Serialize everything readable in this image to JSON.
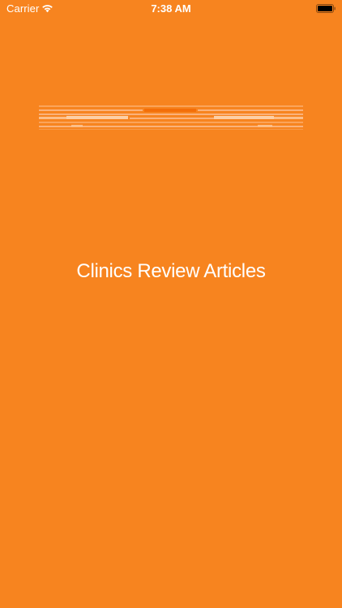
{
  "status_bar": {
    "carrier": "Carrier",
    "wifi_icon": "wifi-icon",
    "time": "7:38 AM",
    "battery_icon": "battery-icon"
  },
  "splash": {
    "logo_icon": "striped-banner-logo-icon",
    "title": "Clinics Review Articles"
  },
  "colors": {
    "background": "#F7841F",
    "text": "#FFFFFF"
  }
}
